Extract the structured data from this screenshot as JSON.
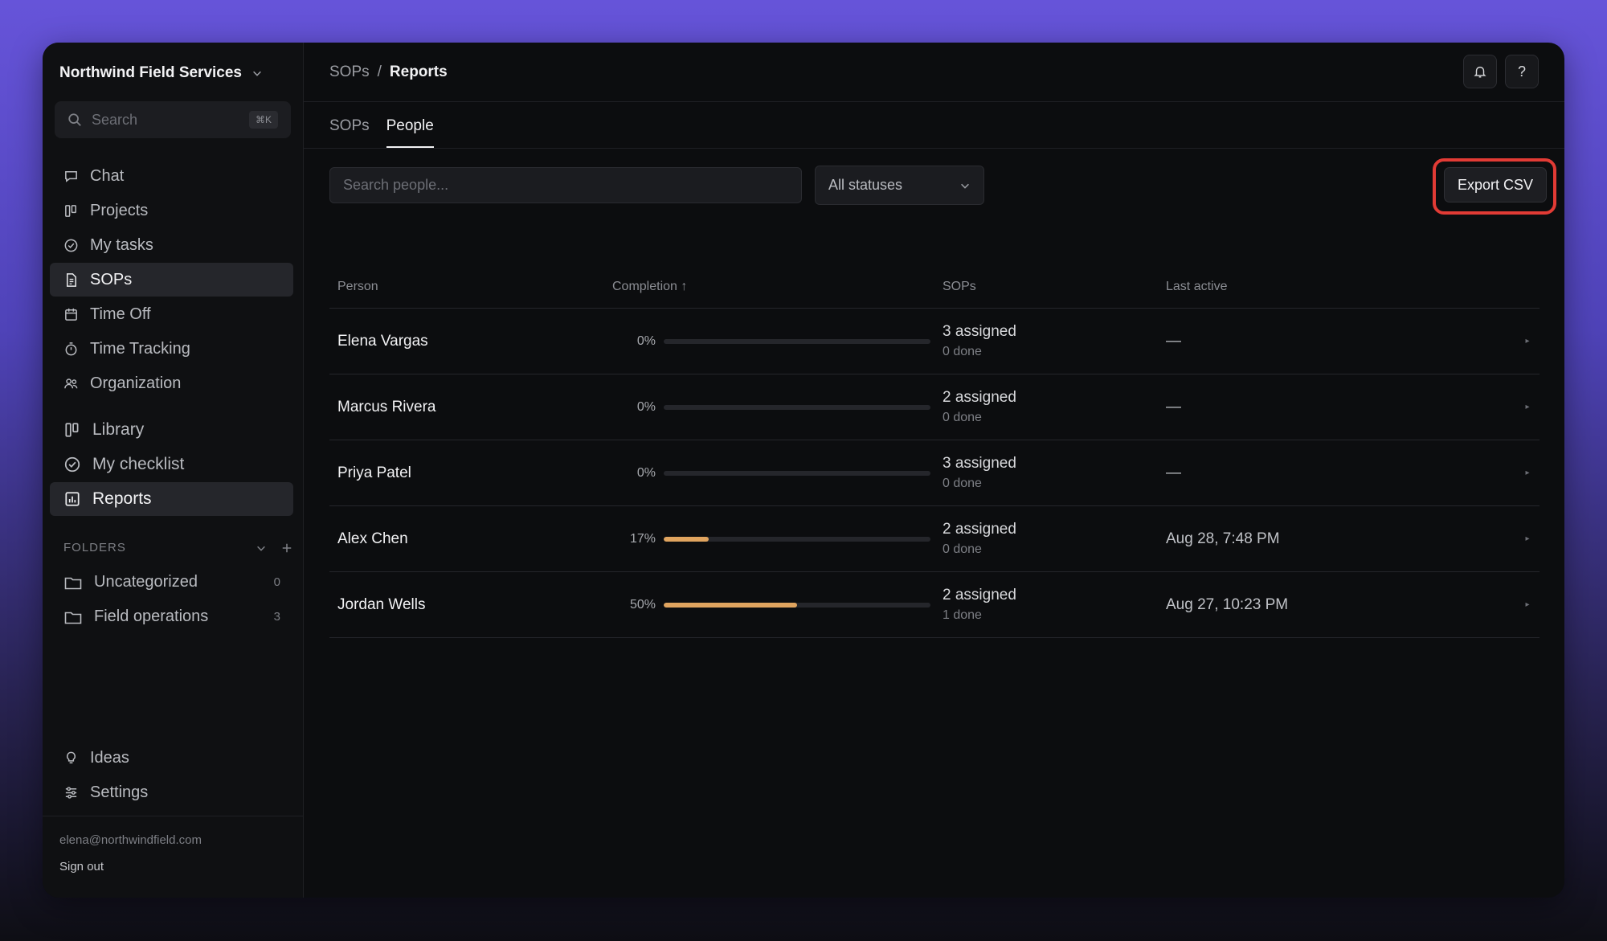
{
  "workspace": {
    "name": "Northwind Field Services"
  },
  "sidebar": {
    "search_placeholder": "Search",
    "search_shortcut": "⌘K",
    "items": [
      {
        "label": "Chat",
        "icon": "chat-icon"
      },
      {
        "label": "Projects",
        "icon": "columns-icon"
      },
      {
        "label": "My tasks",
        "icon": "check-circle-icon"
      },
      {
        "label": "SOPs",
        "icon": "document-icon",
        "active": true
      },
      {
        "label": "Time Off",
        "icon": "calendar-icon"
      },
      {
        "label": "Time Tracking",
        "icon": "stopwatch-icon"
      },
      {
        "label": "Organization",
        "icon": "people-icon"
      }
    ],
    "items2": [
      {
        "label": "Library",
        "icon": "columns-icon"
      },
      {
        "label": "My checklist",
        "icon": "check-circle-icon"
      },
      {
        "label": "Reports",
        "icon": "report-icon",
        "active": true
      }
    ],
    "folders_heading": "FOLDERS",
    "folders": [
      {
        "label": "Uncategorized",
        "count": "0"
      },
      {
        "label": "Field operations",
        "count": "3"
      }
    ],
    "bottom_items": [
      {
        "label": "Ideas",
        "icon": "lightbulb-icon"
      },
      {
        "label": "Settings",
        "icon": "sliders-icon"
      }
    ],
    "user_email": "elena@northwindfield.com",
    "signout_label": "Sign out"
  },
  "header": {
    "breadcrumb_parent": "SOPs",
    "breadcrumb_sep": "/",
    "breadcrumb_current": "Reports",
    "help_label": "?"
  },
  "tabs": [
    {
      "label": "SOPs",
      "active": false
    },
    {
      "label": "People",
      "active": true
    }
  ],
  "toolbar": {
    "search_placeholder": "Search people...",
    "status_value": "All statuses",
    "export_label": "Export CSV"
  },
  "table": {
    "columns": {
      "person": "Person",
      "completion": "Completion ↑",
      "sops": "SOPs",
      "last_active": "Last active"
    },
    "rows": [
      {
        "person": "Elena Vargas",
        "pct_label": "0%",
        "progress": 0,
        "assigned": "3 assigned",
        "done": "0 done",
        "last_active": "—"
      },
      {
        "person": "Marcus Rivera",
        "pct_label": "0%",
        "progress": 0,
        "assigned": "2 assigned",
        "done": "0 done",
        "last_active": "—"
      },
      {
        "person": "Priya Patel",
        "pct_label": "0%",
        "progress": 0,
        "assigned": "3 assigned",
        "done": "0 done",
        "last_active": "—"
      },
      {
        "person": "Alex Chen",
        "pct_label": "17%",
        "progress": 17,
        "assigned": "2 assigned",
        "done": "0 done",
        "last_active": "Aug 28, 7:48 PM"
      },
      {
        "person": "Jordan Wells",
        "pct_label": "50%",
        "progress": 50,
        "assigned": "2 assigned",
        "done": "1 done",
        "last_active": "Aug 27, 10:23 PM"
      }
    ],
    "row_arrow": "▸"
  },
  "colors": {
    "accent_progress": "#e0a45f",
    "highlight_ring": "#e23b35"
  }
}
